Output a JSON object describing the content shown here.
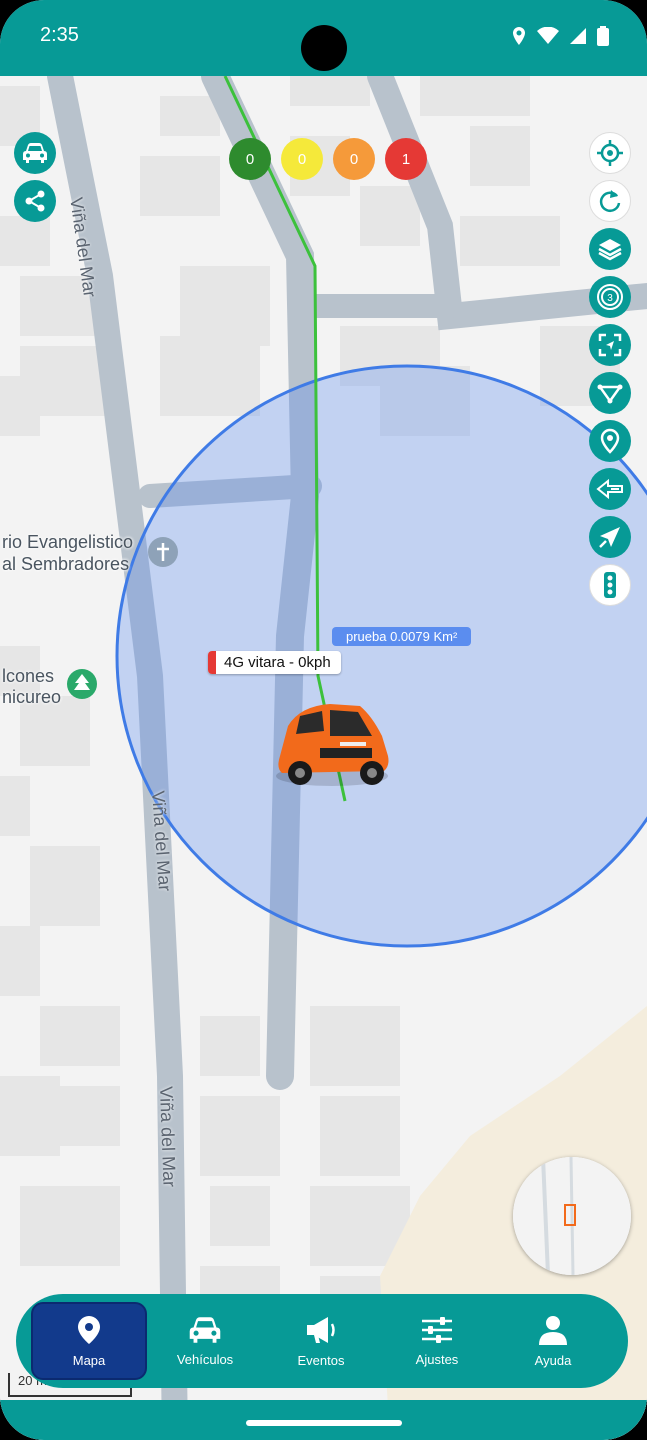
{
  "status": {
    "time": "2:35"
  },
  "counters": [
    {
      "value": "0",
      "color": "#2e8b2e"
    },
    {
      "value": "0",
      "color": "#f5e93a"
    },
    {
      "value": "0",
      "color": "#f59a3a"
    },
    {
      "value": "1",
      "color": "#e53935"
    }
  ],
  "map": {
    "place_label_1": "rio Evangelistico",
    "place_label_2": "al Sembradores",
    "place_label_3": "lcones",
    "place_label_4": "nicureo",
    "street_top": "Viña del Mar",
    "street_mid": "Viña del Mar",
    "street_bottom": "Viña del Mar",
    "scale": "20 m"
  },
  "vehicle": {
    "label": "4G vitara - 0kph"
  },
  "geofence": {
    "label": "prueba 0.0079 Km²"
  },
  "right_buttons": [
    "my-location-icon",
    "refresh-icon",
    "layers-icon",
    "cluster-icon",
    "fit-bounds-icon",
    "route-icon",
    "poi-icon",
    "send-command-icon",
    "navigate-icon",
    "traffic-light-icon"
  ],
  "nav": {
    "items": [
      {
        "label": "Mapa"
      },
      {
        "label": "Vehículos"
      },
      {
        "label": "Eventos"
      },
      {
        "label": "Ajustes"
      },
      {
        "label": "Ayuda"
      }
    ]
  },
  "colors": {
    "primary": "#079a96",
    "active": "#123a8c",
    "geofence": "#3f7be6"
  }
}
